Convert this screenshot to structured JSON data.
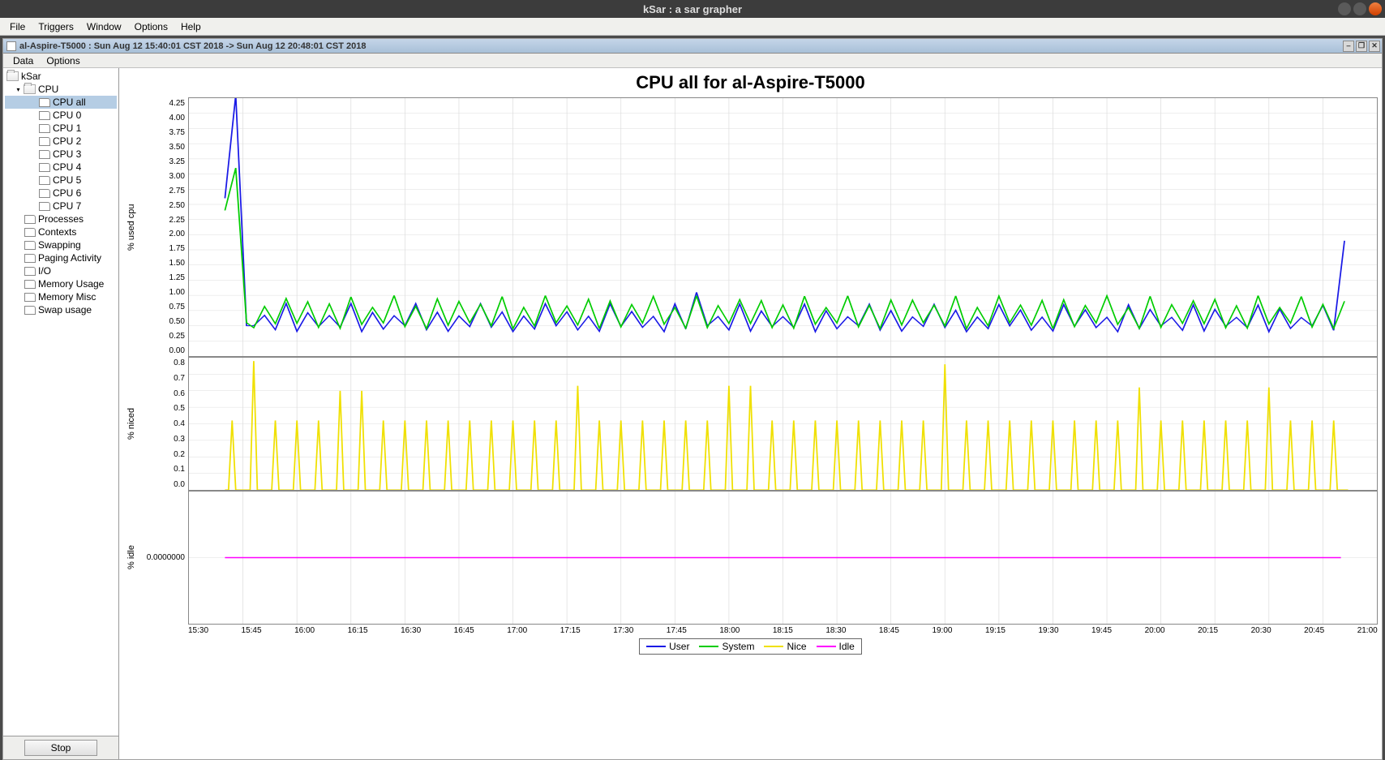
{
  "title_bar": {
    "title": "kSar : a sar grapher"
  },
  "menu": {
    "file": "File",
    "triggers": "Triggers",
    "window": "Window",
    "options": "Options",
    "help": "Help"
  },
  "inner_window": {
    "title": "al-Aspire-T5000 : Sun Aug 12 15:40:01 CST 2018 -> Sun Aug 12 20:48:01 CST 2018"
  },
  "sub_menu": {
    "data": "Data",
    "options": "Options"
  },
  "tree": {
    "root": "kSar",
    "cpu": "CPU",
    "cpu_items": [
      "CPU all",
      "CPU 0",
      "CPU 1",
      "CPU 2",
      "CPU 3",
      "CPU 4",
      "CPU 5",
      "CPU 6",
      "CPU 7"
    ],
    "other_items": [
      "Processes",
      "Contexts",
      "Swapping",
      "Paging Activity",
      "I/O",
      "Memory Usage",
      "Memory Misc",
      "Swap usage"
    ]
  },
  "stop_button": "Stop",
  "chart": {
    "title": "CPU all for al-Aspire-T5000",
    "panel1_ylabel": "% used cpu",
    "panel2_ylabel": "% niced",
    "panel3_ylabel": "% idle",
    "panel1_yticks": [
      "4.25",
      "4.00",
      "3.75",
      "3.50",
      "3.25",
      "3.00",
      "2.75",
      "2.50",
      "2.25",
      "2.00",
      "1.75",
      "1.50",
      "1.25",
      "1.00",
      "0.75",
      "0.50",
      "0.25",
      "0.00"
    ],
    "panel2_yticks": [
      "0.8",
      "0.7",
      "0.6",
      "0.5",
      "0.4",
      "0.3",
      "0.2",
      "0.1",
      "0.0"
    ],
    "panel3_yticks": [
      "0.0000000"
    ],
    "x_ticks": [
      "15:30",
      "15:45",
      "16:00",
      "16:15",
      "16:30",
      "16:45",
      "17:00",
      "17:15",
      "17:30",
      "17:45",
      "18:00",
      "18:15",
      "18:30",
      "18:45",
      "19:00",
      "19:15",
      "19:30",
      "19:45",
      "20:00",
      "20:15",
      "20:30",
      "20:45",
      "21:00"
    ],
    "legend": {
      "user": "User",
      "system": "System",
      "nice": "Nice",
      "idle": "Idle"
    }
  },
  "chart_data": [
    {
      "type": "line",
      "title": "% used cpu",
      "ylabel": "% used cpu",
      "ylim": [
        0,
        4.25
      ],
      "x_range_minutes": [
        940,
        1260
      ],
      "series": [
        {
          "name": "User",
          "color": "#1a1ae6",
          "pattern": "spike_oscillation",
          "initial_spike": 4.3,
          "baseline_range": [
            0.4,
            0.6
          ],
          "peak_range": [
            0.8,
            1.1
          ],
          "large_spikes_at": [
            946,
            1143,
            1248
          ],
          "spike_height": 1.9
        },
        {
          "name": "System",
          "color": "#00cc00",
          "pattern": "spike_oscillation",
          "initial_spike": 3.1,
          "baseline_range": [
            0.45,
            0.65
          ],
          "peak_range": [
            0.85,
            1.1
          ]
        }
      ]
    },
    {
      "type": "line",
      "title": "% niced",
      "ylabel": "% niced",
      "ylim": [
        0,
        0.8
      ],
      "x_range_minutes": [
        940,
        1260
      ],
      "series": [
        {
          "name": "Nice",
          "color": "#f0e000",
          "pattern": "periodic_spikes",
          "baseline": 0,
          "common_peak": 0.42,
          "high_peaks_at": [
            946,
            975,
            1038,
            1083,
            1139,
            1193,
            1228
          ],
          "high_peak_height": [
            0.78,
            0.6,
            0.63,
            0.63,
            0.76,
            0.62,
            0.62
          ]
        }
      ]
    },
    {
      "type": "line",
      "title": "% idle",
      "ylabel": "% idle",
      "ylim": [
        -0.01,
        0.01
      ],
      "x_range_minutes": [
        940,
        1260
      ],
      "series": [
        {
          "name": "Idle",
          "color": "#ff00ff",
          "pattern": "flat",
          "value": 0
        }
      ]
    }
  ],
  "colors": {
    "user": "#1a1ae6",
    "system": "#00cc00",
    "nice": "#f0e000",
    "idle": "#ff00ff"
  }
}
